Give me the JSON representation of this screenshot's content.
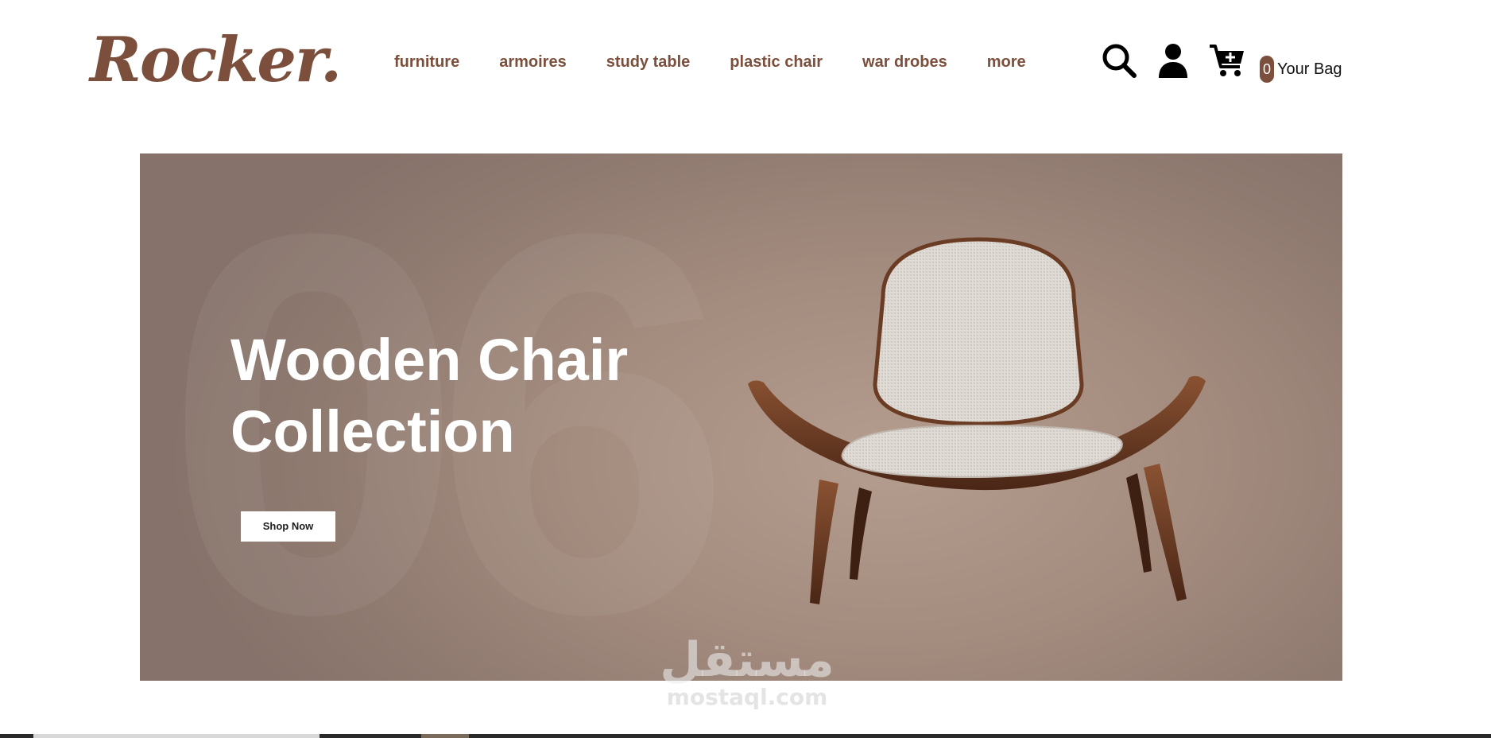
{
  "brand": {
    "logo_text": "Rocker",
    "logo_dot": ".",
    "accent_color": "#7b4f3c"
  },
  "nav": {
    "items": [
      {
        "label": "furniture"
      },
      {
        "label": "armoires"
      },
      {
        "label": "study table"
      },
      {
        "label": "plastic chair"
      },
      {
        "label": "war drobes"
      },
      {
        "label": "more"
      }
    ]
  },
  "header_icons": {
    "search": "search-icon",
    "account": "user-icon",
    "cart": "cart-plus-icon",
    "cart_count": "0",
    "bag_label": "Your Bag"
  },
  "hero": {
    "title_line1": "Wooden Chair",
    "title_line2": "Collection",
    "cta_label": "Shop Now",
    "background_color": "#a38b7e",
    "deco_text": "06"
  },
  "watermark": {
    "arabic": "مستقل",
    "latin": "mostaql.com"
  }
}
